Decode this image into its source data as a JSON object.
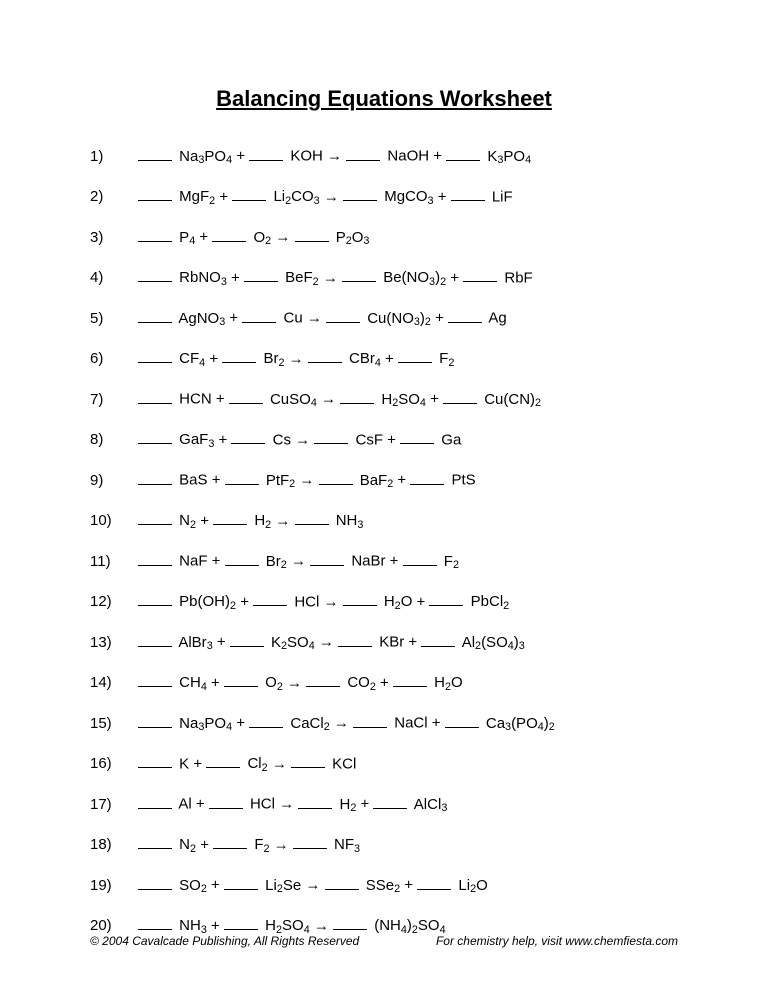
{
  "title": "Balancing Equations Worksheet",
  "arrow": "→",
  "plus": " + ",
  "problems": [
    {
      "n": "1)",
      "terms": [
        [
          "Na",
          "3",
          "PO",
          "4"
        ],
        [
          "KOH"
        ]
      ],
      "products": [
        [
          "NaOH"
        ],
        [
          "K",
          "3",
          "PO",
          "4"
        ]
      ]
    },
    {
      "n": "2)",
      "terms": [
        [
          "MgF",
          "2"
        ],
        [
          "Li",
          "2",
          "CO",
          "3"
        ]
      ],
      "products": [
        [
          "MgCO",
          "3"
        ],
        [
          "LiF"
        ]
      ]
    },
    {
      "n": "3)",
      "terms": [
        [
          "P",
          "4"
        ],
        [
          "O",
          "2"
        ]
      ],
      "products": [
        [
          "P",
          "2",
          "O",
          "3"
        ]
      ]
    },
    {
      "n": "4)",
      "terms": [
        [
          "RbNO",
          "3"
        ],
        [
          "BeF",
          "2"
        ]
      ],
      "products": [
        [
          "Be(NO",
          "3",
          ")",
          "2"
        ],
        [
          "RbF"
        ]
      ]
    },
    {
      "n": "5)",
      "terms": [
        [
          "AgNO",
          "3"
        ],
        [
          "Cu"
        ]
      ],
      "products": [
        [
          "Cu(NO",
          "3",
          ")",
          "2"
        ],
        [
          "Ag"
        ]
      ]
    },
    {
      "n": "6)",
      "terms": [
        [
          "CF",
          "4"
        ],
        [
          "Br",
          "2"
        ]
      ],
      "products": [
        [
          "CBr",
          "4"
        ],
        [
          "F",
          "2"
        ]
      ]
    },
    {
      "n": "7)",
      "terms": [
        [
          "HCN"
        ],
        [
          "CuSO",
          "4"
        ]
      ],
      "products": [
        [
          "H",
          "2",
          "SO",
          "4"
        ],
        [
          "Cu(CN)",
          "2"
        ]
      ]
    },
    {
      "n": "8)",
      "terms": [
        [
          "GaF",
          "3"
        ],
        [
          "Cs"
        ]
      ],
      "products": [
        [
          "CsF"
        ],
        [
          "Ga"
        ]
      ]
    },
    {
      "n": "9)",
      "terms": [
        [
          "BaS"
        ],
        [
          "PtF",
          "2"
        ]
      ],
      "products": [
        [
          "BaF",
          "2"
        ],
        [
          "PtS"
        ]
      ]
    },
    {
      "n": "10)",
      "terms": [
        [
          "N",
          "2"
        ],
        [
          "H",
          "2"
        ]
      ],
      "products": [
        [
          "NH",
          "3"
        ]
      ]
    },
    {
      "n": "11)",
      "terms": [
        [
          "NaF"
        ],
        [
          "Br",
          "2"
        ]
      ],
      "products": [
        [
          "NaBr"
        ],
        [
          "F",
          "2"
        ]
      ]
    },
    {
      "n": "12)",
      "terms": [
        [
          "Pb(OH)",
          "2"
        ],
        [
          "HCl"
        ]
      ],
      "products": [
        [
          "H",
          "2",
          "O"
        ],
        [
          "PbCl",
          "2"
        ]
      ]
    },
    {
      "n": "13)",
      "terms": [
        [
          "AlBr",
          "3"
        ],
        [
          "K",
          "2",
          "SO",
          "4"
        ]
      ],
      "products": [
        [
          "KBr"
        ],
        [
          "Al",
          "2",
          "(SO",
          "4",
          ")",
          "3"
        ]
      ]
    },
    {
      "n": "14)",
      "terms": [
        [
          "CH",
          "4"
        ],
        [
          "O",
          "2"
        ]
      ],
      "products": [
        [
          "CO",
          "2"
        ],
        [
          "H",
          "2",
          "O"
        ]
      ]
    },
    {
      "n": "15)",
      "terms": [
        [
          "Na",
          "3",
          "PO",
          "4"
        ],
        [
          "CaCl",
          "2"
        ]
      ],
      "products": [
        [
          "NaCl"
        ],
        [
          "Ca",
          "3",
          "(PO",
          "4",
          ")",
          "2"
        ]
      ]
    },
    {
      "n": "16)",
      "terms": [
        [
          "K"
        ],
        [
          "Cl",
          "2"
        ]
      ],
      "products": [
        [
          "KCl"
        ]
      ]
    },
    {
      "n": "17)",
      "terms": [
        [
          "Al"
        ],
        [
          "HCl"
        ]
      ],
      "products": [
        [
          "H",
          "2"
        ],
        [
          "AlCl",
          "3"
        ]
      ]
    },
    {
      "n": "18)",
      "terms": [
        [
          "N",
          "2"
        ],
        [
          "F",
          "2"
        ]
      ],
      "products": [
        [
          "NF",
          "3"
        ]
      ]
    },
    {
      "n": "19)",
      "terms": [
        [
          "SO",
          "2"
        ],
        [
          "Li",
          "2",
          "Se"
        ]
      ],
      "products": [
        [
          "SSe",
          "2"
        ],
        [
          "Li",
          "2",
          "O"
        ]
      ]
    },
    {
      "n": "20)",
      "terms": [
        [
          "NH",
          "3"
        ],
        [
          "H",
          "2",
          "SO",
          "4"
        ]
      ],
      "products": [
        [
          "(NH",
          "4",
          ")",
          "2",
          "SO",
          "4"
        ]
      ]
    }
  ],
  "footer": {
    "left": "© 2004 Cavalcade Publishing, All Rights Reserved",
    "right": "For chemistry help, visit www.chemfiesta.com"
  }
}
